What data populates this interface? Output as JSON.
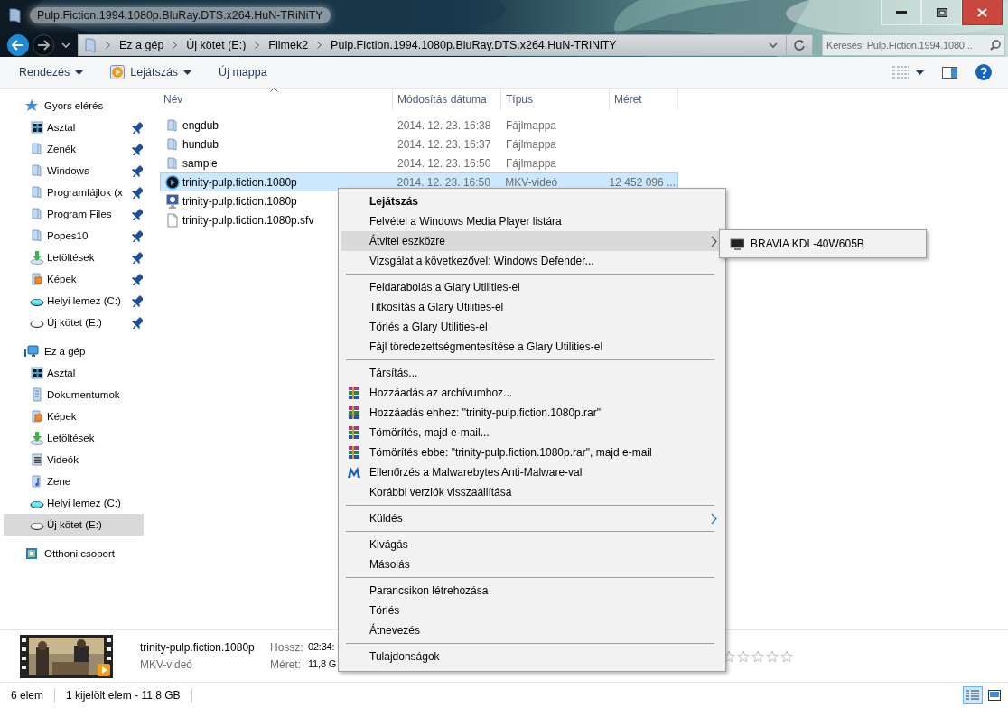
{
  "window": {
    "title": "Pulp.Fiction.1994.1080p.BluRay.DTS.x264.HuN-TRiNiTY"
  },
  "address_bar": {
    "path": [
      "Ez a gép",
      "Új kötet (E:)",
      "Filmek2",
      "Pulp.Fiction.1994.1080p.BluRay.DTS.x264.HuN-TRiNiTY"
    ],
    "search": {
      "placeholder": "Keresés: Pulp.Fiction.1994.1080..."
    }
  },
  "toolbar": {
    "buttons": [
      {
        "label": "Rendezés",
        "kind": "menu"
      },
      {
        "label": "Lejátszás",
        "kind": "play"
      },
      {
        "label": "Új mappa",
        "kind": "plain"
      }
    ]
  },
  "sidebar": {
    "groups": [
      {
        "label": "Gyors elérés",
        "kind": "star",
        "children": [
          {
            "label": "Asztal",
            "kind": "desktop",
            "pinned": true,
            "selected": false
          },
          {
            "label": "Zenék",
            "kind": "folder",
            "pinned": true,
            "selected": false
          },
          {
            "label": "Windows",
            "kind": "folder",
            "pinned": true,
            "selected": false
          },
          {
            "label": "Programfájlok (x",
            "kind": "folder",
            "pinned": true,
            "selected": false
          },
          {
            "label": "Program Files",
            "kind": "folder",
            "pinned": true,
            "selected": false
          },
          {
            "label": "Popes10",
            "kind": "folder",
            "pinned": true,
            "selected": false
          },
          {
            "label": "Letöltések",
            "kind": "download",
            "pinned": true,
            "selected": false
          },
          {
            "label": "Képek",
            "kind": "pictures",
            "pinned": true,
            "selected": false
          },
          {
            "label": "Helyi lemez (C:)",
            "kind": "system_drive",
            "pinned": true,
            "selected": false
          },
          {
            "label": "Új kötet (E:)",
            "kind": "drive",
            "pinned": true,
            "selected": false
          }
        ]
      },
      {
        "label": "Ez a gép",
        "kind": "computer",
        "children": [
          {
            "label": "Asztal",
            "kind": "desktop",
            "pinned": false,
            "selected": false
          },
          {
            "label": "Dokumentumok",
            "kind": "documents",
            "pinned": false,
            "selected": false
          },
          {
            "label": "Képek",
            "kind": "pictures",
            "pinned": false,
            "selected": false
          },
          {
            "label": "Letöltések",
            "kind": "download",
            "pinned": false,
            "selected": false
          },
          {
            "label": "Videók",
            "kind": "videos",
            "pinned": false,
            "selected": false
          },
          {
            "label": "Zene",
            "kind": "music",
            "pinned": false,
            "selected": false
          },
          {
            "label": "Helyi lemez (C:)",
            "kind": "system_drive",
            "pinned": false,
            "selected": false
          },
          {
            "label": "Új kötet (E:)",
            "kind": "drive",
            "pinned": false,
            "selected": true
          }
        ]
      },
      {
        "label": "Otthoni csoport",
        "kind": "homegroup"
      }
    ]
  },
  "file_list": {
    "columns": [
      "Név",
      "Módosítás dátuma",
      "Típus",
      "Méret"
    ],
    "rows": [
      {
        "name": "engdub",
        "date": "2014. 12. 23. 16:38",
        "type": "Fájlmappa",
        "kind": "folder",
        "selected": false
      },
      {
        "name": "hundub",
        "date": "2014. 12. 23. 16:37",
        "type": "Fájlmappa",
        "kind": "folder",
        "selected": false
      },
      {
        "name": "sample",
        "date": "2014. 12. 23. 16:50",
        "type": "Fájlmappa",
        "kind": "folder",
        "selected": false
      },
      {
        "name": "trinity-pulp.fiction.1080p",
        "date": "2014. 12. 23. 16:50",
        "type": "MKV-videó",
        "size": "12 452 096 ...",
        "kind": "video",
        "selected": true
      },
      {
        "name": "trinity-pulp.fiction.1080p",
        "kind": "info",
        "selected": false
      },
      {
        "name": "trinity-pulp.fiction.1080p.sfv",
        "kind": "file",
        "selected": false
      }
    ]
  },
  "context_menu": {
    "sections": [
      {
        "items": [
          {
            "label": "Lejátszás",
            "kind": "plain",
            "default": true,
            "selected": false,
            "submenu": false
          },
          {
            "label": "Felvétel a Windows Media Player listára",
            "kind": "plain",
            "default": false,
            "selected": false,
            "submenu": false
          },
          {
            "label": "Átvitel eszközre",
            "kind": "plain",
            "default": false,
            "selected": true,
            "submenu": true
          },
          {
            "label": "Vizsgálat a következővel: Windows Defender...",
            "kind": "plain",
            "default": false,
            "selected": false,
            "submenu": false
          }
        ]
      },
      {
        "items": [
          {
            "label": "Feldarabolás a Glary Utilities-el",
            "kind": "plain",
            "default": false,
            "selected": false,
            "submenu": false
          },
          {
            "label": "Titkosítás a Glary Utilities-el",
            "kind": "plain",
            "default": false,
            "selected": false,
            "submenu": false
          },
          {
            "label": "Törlés a Glary Utilities-el",
            "kind": "plain",
            "default": false,
            "selected": false,
            "submenu": false
          },
          {
            "label": "Fájl töredezettségmentesítése a Glary Utilities-el",
            "kind": "plain",
            "default": false,
            "selected": false,
            "submenu": false
          }
        ]
      },
      {
        "items": [
          {
            "label": "Társítás...",
            "kind": "plain",
            "default": false,
            "selected": false,
            "submenu": false
          },
          {
            "label": "Hozzáadás az archívumhoz...",
            "kind": "archive",
            "default": false,
            "selected": false,
            "submenu": false
          },
          {
            "label": "Hozzáadás ehhez: \"trinity-pulp.fiction.1080p.rar\"",
            "kind": "archive",
            "default": false,
            "selected": false,
            "submenu": false
          },
          {
            "label": "Tömörítés, majd e-mail...",
            "kind": "archive",
            "default": false,
            "selected": false,
            "submenu": false
          },
          {
            "label": "Tömörítés ebbe: \"trinity-pulp.fiction.1080p.rar\", majd e-mail",
            "kind": "archive",
            "default": false,
            "selected": false,
            "submenu": false
          },
          {
            "label": "Ellenőrzés a Malwarebytes Anti-Malware-val",
            "kind": "scanner",
            "default": false,
            "selected": false,
            "submenu": false
          },
          {
            "label": "Korábbi verziók visszaállítása",
            "kind": "plain",
            "default": false,
            "selected": false,
            "submenu": false
          }
        ]
      },
      {
        "items": [
          {
            "label": "Küldés",
            "kind": "plain",
            "default": false,
            "selected": false,
            "submenu": true
          }
        ]
      },
      {
        "items": [
          {
            "label": "Kivágás",
            "kind": "plain",
            "default": false,
            "selected": false,
            "submenu": false
          },
          {
            "label": "Másolás",
            "kind": "plain",
            "default": false,
            "selected": false,
            "submenu": false
          }
        ]
      },
      {
        "items": [
          {
            "label": "Parancsikon létrehozása",
            "kind": "plain",
            "default": false,
            "selected": false,
            "submenu": false
          },
          {
            "label": "Törlés",
            "kind": "plain",
            "default": false,
            "selected": false,
            "submenu": false
          },
          {
            "label": "Átnevezés",
            "kind": "plain",
            "default": false,
            "selected": false,
            "submenu": false
          }
        ]
      },
      {
        "items": [
          {
            "label": "Tulajdonságok",
            "kind": "plain",
            "default": false,
            "selected": false,
            "submenu": false
          }
        ]
      }
    ]
  },
  "submenu": {
    "items": [
      {
        "label": "BRAVIA KDL-40W605B",
        "kind": "tv"
      }
    ]
  },
  "details": {
    "name": "trinity-pulp.fiction.1080p",
    "type": "MKV-videó",
    "fields": [
      {
        "label": "Hossz:",
        "value": "02:34:"
      },
      {
        "label": "Méret:",
        "value": "11,8 G"
      }
    ],
    "stars": 0
  },
  "status_bar": {
    "items": [
      "6 elem",
      "1 kijelölt elem - 11,8 GB"
    ],
    "views": [
      {
        "kind": "details",
        "selected": true
      },
      {
        "kind": "large_icons",
        "selected": false
      }
    ]
  }
}
